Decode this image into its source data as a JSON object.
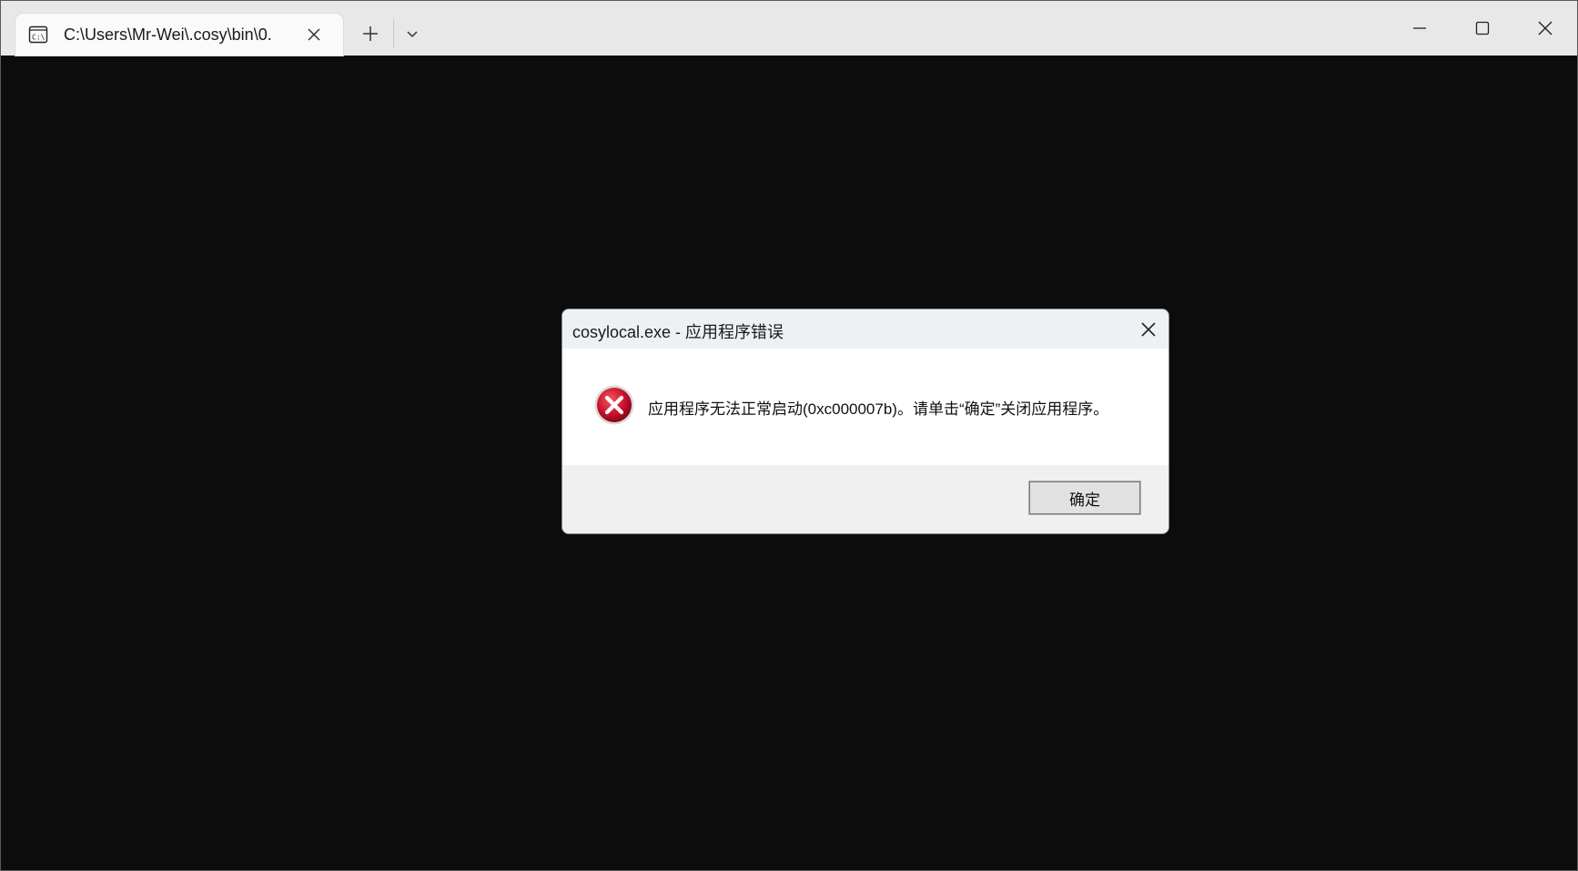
{
  "window": {
    "tab_title": "C:\\Users\\Mr-Wei\\.cosy\\bin\\0.",
    "tab_icon": "console-icon",
    "controls": {
      "new_tab": "plus-icon",
      "dropdown": "chevron-down-icon",
      "minimize": "minimize-icon",
      "maximize": "maximize-icon",
      "close": "close-icon"
    },
    "console_background": "#0c0c0c"
  },
  "dialog": {
    "title": "cosylocal.exe - 应用程序错误",
    "message": "应用程序无法正常启动(0xc000007b)。请单击“确定”关闭应用程序。",
    "ok_label": "确定",
    "icon": "error-icon",
    "icon_color": "#c8102e"
  }
}
